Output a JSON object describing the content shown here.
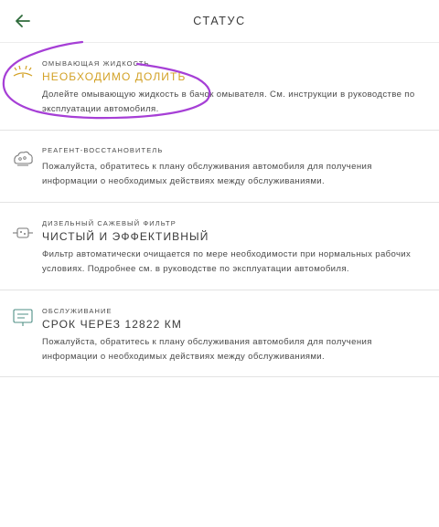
{
  "header": {
    "title": "СТАТУС",
    "back_icon": "arrow-left-icon",
    "back_color": "#2e6b3b"
  },
  "items": [
    {
      "icon": "washer-fluid-icon",
      "category": "ОМЫВАЮЩАЯ ЖИДКОСТЬ",
      "status": "НЕОБХОДИМО ДОЛИТЬ",
      "status_color": "#d3a227",
      "description": "Долейте омывающую жидкость в бачок омывателя. См. инструкции в руководстве по эксплуатации автомобиля."
    },
    {
      "icon": "reductant-icon",
      "category": "РЕАГЕНТ-ВОССТАНОВИТЕЛЬ",
      "status": "",
      "description": "Пожалуйста, обратитесь к плану обслуживания автомобиля для получения информации о необходимых действиях между обслуживаниями."
    },
    {
      "icon": "diesel-particulate-filter-icon",
      "category": "ДИЗЕЛЬНЫЙ САЖЕВЫЙ ФИЛЬТР",
      "status": "ЧИСТЫЙ И ЭФФЕКТИВНЫЙ",
      "description": "Фильтр автоматически очищается по мере необходимости при нормальных рабочих условиях. Подробнее см. в руководстве по эксплуатации автомобиля."
    },
    {
      "icon": "service-book-icon",
      "category": "ОБСЛУЖИВАНИЕ",
      "status": "СРОК ЧЕРЕЗ 12822 КМ",
      "description": "Пожалуйста, обратитесь к плану обслуживания автомобиля для получения информации о необходимых действиях между обслуживаниями."
    }
  ],
  "annotation": {
    "ring_color": "#a63fd6"
  }
}
